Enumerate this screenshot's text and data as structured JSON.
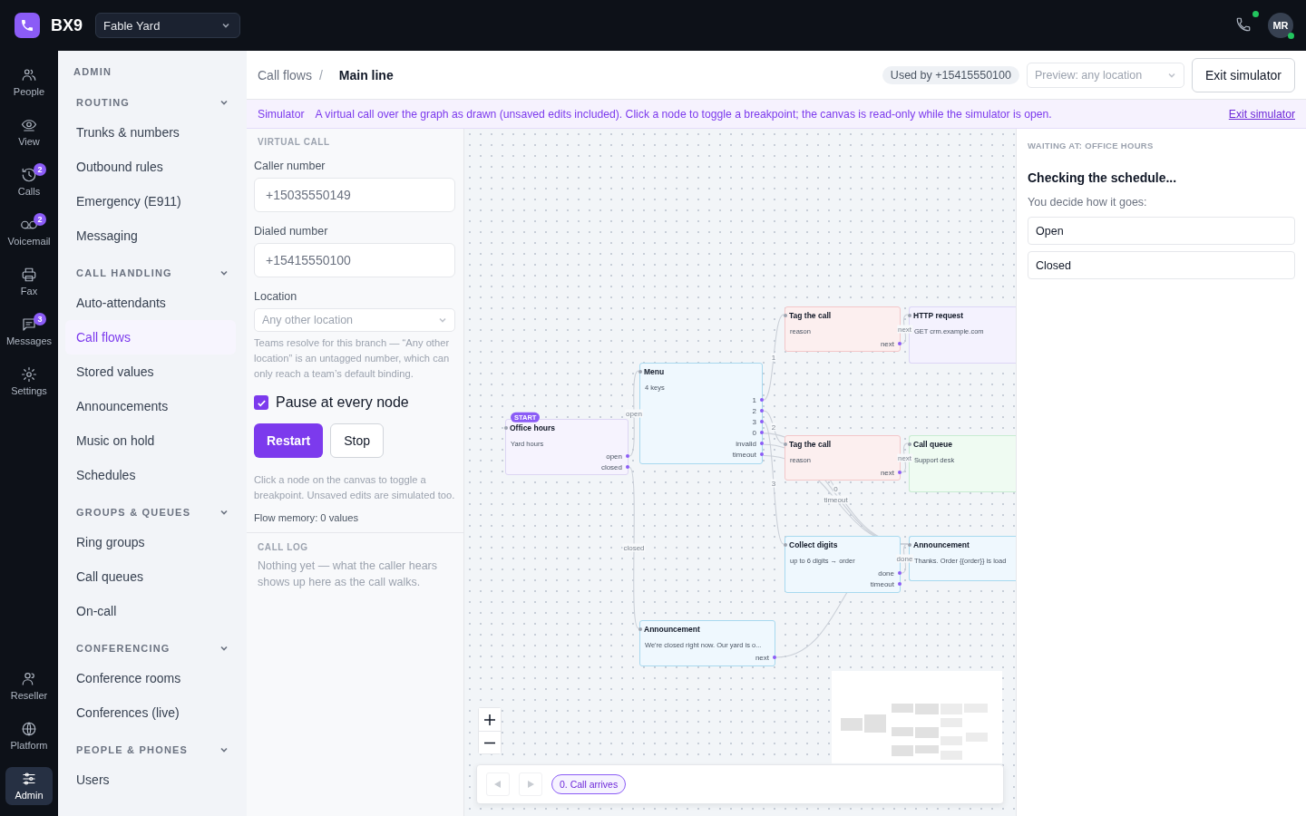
{
  "topbar": {
    "app_name": "BX9",
    "org": "Fable Yard",
    "call_online": true,
    "avatar": "MR",
    "avatar_online": true
  },
  "rail": {
    "top": [
      {
        "kind": "people",
        "label": "People",
        "selected": false
      },
      {
        "kind": "view",
        "label": "View",
        "selected": false
      },
      {
        "kind": "calls",
        "label": "Calls",
        "badge": "2",
        "selected": false
      },
      {
        "kind": "voicemail",
        "label": "Voicemail",
        "badge": "2",
        "selected": false
      },
      {
        "kind": "fax",
        "label": "Fax",
        "selected": false
      },
      {
        "kind": "messages",
        "label": "Messages",
        "badge": "3",
        "selected": false
      },
      {
        "kind": "settings",
        "label": "Settings",
        "selected": false
      }
    ],
    "bottom": [
      {
        "kind": "reseller",
        "label": "Reseller",
        "selected": false
      },
      {
        "kind": "platform",
        "label": "Platform",
        "selected": false
      },
      {
        "kind": "admin",
        "label": "Admin",
        "selected": true
      }
    ]
  },
  "sidebar": {
    "title": "ADMIN",
    "sections": [
      {
        "label": "ROUTING",
        "expanded": true,
        "items": [
          {
            "label": "Trunks & numbers",
            "selected": false
          },
          {
            "label": "Outbound rules",
            "selected": false
          },
          {
            "label": "Emergency (E911)",
            "selected": false
          },
          {
            "label": "Messaging",
            "selected": false
          }
        ]
      },
      {
        "label": "CALL HANDLING",
        "expanded": true,
        "items": [
          {
            "label": "Auto-attendants",
            "selected": false
          },
          {
            "label": "Call flows",
            "selected": true
          },
          {
            "label": "Stored values",
            "selected": false
          },
          {
            "label": "Announcements",
            "selected": false
          },
          {
            "label": "Music on hold",
            "selected": false
          },
          {
            "label": "Schedules",
            "selected": false
          }
        ]
      },
      {
        "label": "GROUPS & QUEUES",
        "expanded": true,
        "items": [
          {
            "label": "Ring groups",
            "selected": false
          },
          {
            "label": "Call queues",
            "selected": false
          },
          {
            "label": "On-call",
            "selected": false
          }
        ]
      },
      {
        "label": "CONFERENCING",
        "expanded": true,
        "items": [
          {
            "label": "Conference rooms",
            "selected": false
          },
          {
            "label": "Conferences (live)",
            "selected": false
          }
        ]
      },
      {
        "label": "PEOPLE & PHONES",
        "expanded": true,
        "items": [
          {
            "label": "Users",
            "selected": false
          }
        ]
      }
    ]
  },
  "header": {
    "breadcrumb": [
      "Call flows",
      "Main line"
    ],
    "separator": "/",
    "used_by": "Used by +15415550100",
    "preview": {
      "placeholder": "Preview: any location"
    },
    "exit_button": "Exit simulator"
  },
  "banner": {
    "label": "Simulator",
    "text": "A virtual call over the graph as drawn (unsaved edits included). Click a node to toggle a breakpoint; the canvas is read-only while the simulator is open.",
    "link": "Exit simulator"
  },
  "virtual_call": {
    "title": "VIRTUAL CALL",
    "fields": [
      {
        "label": "Caller number",
        "placeholder": "+15035550149"
      },
      {
        "label": "Dialed number",
        "placeholder": "+15415550100"
      }
    ],
    "location": {
      "label": "Location",
      "value": "Any other location",
      "disabled": true
    },
    "location_hint": "Teams resolve for this branch — “Any other location” is an untagged number, which can only reach a team’s default binding.",
    "pause": {
      "label": "Pause at every node",
      "checked": true
    },
    "buttons": [
      {
        "kind": "primary",
        "label": "Restart"
      },
      {
        "kind": "secondary",
        "label": "Stop"
      }
    ],
    "help": "Click a node on the canvas to toggle a breakpoint. Unsaved edits are simulated too.",
    "memory": "Flow memory: 0 values"
  },
  "call_log": {
    "title": "CALL LOG",
    "empty": "Nothing yet — what the caller hears shows up here as the call walks."
  },
  "canvas": {
    "nodes": [
      {
        "kind": "schedule",
        "title": "Office hours",
        "badge": "START",
        "subtitle": "Yard hours",
        "ports": [
          {
            "label": "open",
            "edge_label": "open"
          },
          {
            "label": "closed",
            "edge_label": "closed"
          }
        ]
      },
      {
        "kind": "menu",
        "title": "Menu",
        "subtitle": "4 keys",
        "ports": [
          {
            "label": "1",
            "edge_label": "1"
          },
          {
            "label": "2",
            "edge_label": "2"
          },
          {
            "label": "3",
            "edge_label": "3"
          },
          {
            "label": "0",
            "edge_label": "0"
          },
          {
            "label": "invalid"
          },
          {
            "label": "timeout",
            "edge_label": "timeout"
          }
        ]
      },
      {
        "kind": "tag",
        "title": "Tag the call",
        "subtitle": "reason",
        "ports": [
          {
            "label": "next",
            "edge_label": "next"
          }
        ]
      },
      {
        "kind": "http",
        "title": "HTTP request",
        "subtitle": "GET crm.example.com"
      },
      {
        "kind": "tag",
        "title": "Tag the call",
        "subtitle": "reason",
        "ports": [
          {
            "label": "next",
            "edge_label": "next"
          }
        ]
      },
      {
        "kind": "queue",
        "title": "Call queue",
        "subtitle": "Support desk"
      },
      {
        "kind": "collect",
        "title": "Collect digits",
        "subtitle": "up to 6 digits → order",
        "ports": [
          {
            "label": "done",
            "edge_label": "done"
          },
          {
            "label": "timeout"
          }
        ]
      },
      {
        "kind": "announcement",
        "title": "Announcement",
        "subtitle": "Thanks. Order {{order}} is load"
      },
      {
        "kind": "announcement",
        "title": "Announcement",
        "subtitle": "We're closed right now. Our yard is o...",
        "ports": [
          {
            "label": "next"
          }
        ]
      }
    ],
    "steps": {
      "nav": [
        {
          "kind": "prev",
          "disabled": true
        },
        {
          "kind": "next",
          "disabled": true
        }
      ],
      "chips": [
        {
          "label": "0. Call arrives",
          "selected": true
        }
      ]
    }
  },
  "decision": {
    "waiting": "WAITING AT: OFFICE HOURS",
    "heading": "Checking the schedule...",
    "prompt": "You decide how it goes:",
    "options": [
      "Open",
      "Closed"
    ]
  }
}
